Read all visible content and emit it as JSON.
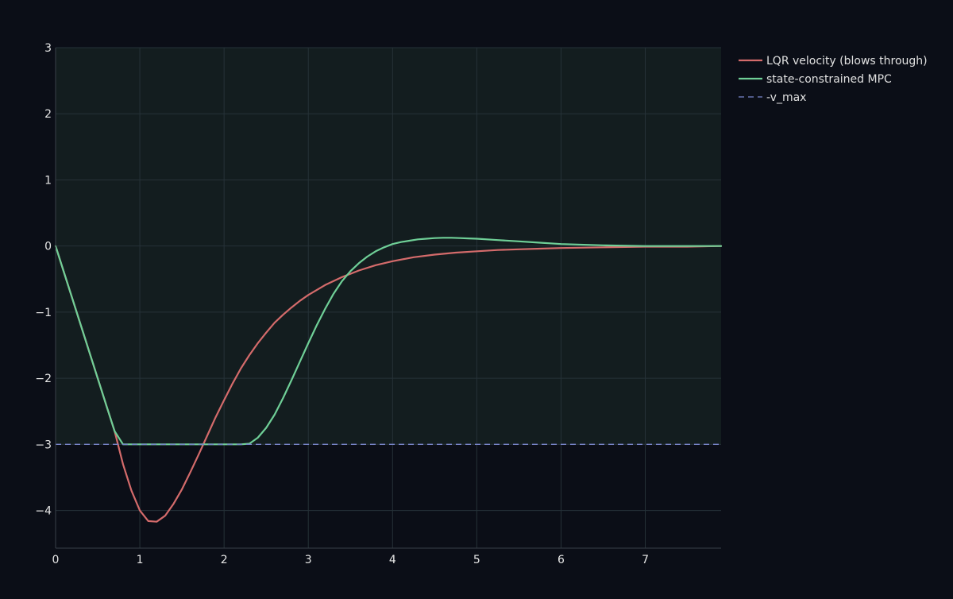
{
  "chart_data": {
    "type": "line",
    "title": "",
    "xlabel": "",
    "ylabel": "",
    "xlim": [
      0,
      7.9
    ],
    "ylim": [
      -4.57,
      3
    ],
    "x_ticks": [
      0,
      1,
      2,
      3,
      4,
      5,
      6,
      7
    ],
    "y_ticks": [
      3,
      2,
      1,
      0,
      -1,
      -2,
      -3,
      -4
    ],
    "x_tick_labels": [
      "0",
      "1",
      "2",
      "3",
      "4",
      "5",
      "6",
      "7"
    ],
    "y_tick_labels": [
      "3",
      "2",
      "1",
      "0",
      "−1",
      "−2",
      "−3",
      "−4"
    ],
    "grid": true,
    "legend_position": "top-right, outside plot",
    "colors": {
      "background": "#0b0e17",
      "feasible_region": "#131d1f",
      "grid": "#263238",
      "axis_line": "#3a4048",
      "tick_label": "#e6e6e6",
      "legend_text": "#e0e0e0"
    },
    "shaded_region": {
      "y_from": -3,
      "y_to": 3,
      "color": "#131d1f"
    },
    "series": [
      {
        "name": "LQR velocity (blows through)",
        "color": "#d46b6b",
        "dash": "solid",
        "x": [
          0,
          0.1,
          0.2,
          0.3,
          0.4,
          0.5,
          0.6,
          0.7,
          0.8,
          0.9,
          1.0,
          1.1,
          1.2,
          1.3,
          1.4,
          1.5,
          1.6,
          1.7,
          1.8,
          1.9,
          2.0,
          2.1,
          2.2,
          2.3,
          2.4,
          2.5,
          2.6,
          2.7,
          2.8,
          2.9,
          3.0,
          3.2,
          3.4,
          3.6,
          3.8,
          4.0,
          4.25,
          4.5,
          4.75,
          5.0,
          5.25,
          5.5,
          5.75,
          6.0,
          6.5,
          7.0,
          7.5,
          7.9
        ],
        "y": [
          0,
          -0.4,
          -0.8,
          -1.2,
          -1.6,
          -2.0,
          -2.4,
          -2.8,
          -3.3,
          -3.7,
          -4.0,
          -4.16,
          -4.17,
          -4.08,
          -3.9,
          -3.68,
          -3.42,
          -3.15,
          -2.87,
          -2.59,
          -2.33,
          -2.08,
          -1.85,
          -1.65,
          -1.47,
          -1.31,
          -1.16,
          -1.04,
          -0.93,
          -0.83,
          -0.74,
          -0.59,
          -0.47,
          -0.37,
          -0.29,
          -0.23,
          -0.17,
          -0.13,
          -0.1,
          -0.08,
          -0.06,
          -0.05,
          -0.04,
          -0.03,
          -0.02,
          -0.01,
          -0.01,
          0
        ]
      },
      {
        "name": "state-constrained MPC",
        "color": "#6fcf97",
        "dash": "solid",
        "x": [
          0,
          0.1,
          0.2,
          0.3,
          0.4,
          0.5,
          0.6,
          0.7,
          0.8,
          1.0,
          1.5,
          2.0,
          2.2,
          2.3,
          2.4,
          2.5,
          2.6,
          2.7,
          2.8,
          2.9,
          3.0,
          3.1,
          3.2,
          3.3,
          3.4,
          3.5,
          3.6,
          3.7,
          3.8,
          3.9,
          4.0,
          4.1,
          4.2,
          4.3,
          4.4,
          4.5,
          4.6,
          4.7,
          4.8,
          4.9,
          5.0,
          5.25,
          5.5,
          5.75,
          6.0,
          6.5,
          7.0,
          7.5,
          7.9
        ],
        "y": [
          0,
          -0.4,
          -0.8,
          -1.2,
          -1.6,
          -2.0,
          -2.4,
          -2.8,
          -3.0,
          -3.0,
          -3.0,
          -3.0,
          -3.0,
          -2.99,
          -2.9,
          -2.75,
          -2.55,
          -2.3,
          -2.03,
          -1.75,
          -1.47,
          -1.2,
          -0.95,
          -0.72,
          -0.53,
          -0.38,
          -0.26,
          -0.16,
          -0.08,
          -0.02,
          0.03,
          0.06,
          0.08,
          0.1,
          0.11,
          0.12,
          0.125,
          0.125,
          0.12,
          0.115,
          0.11,
          0.09,
          0.07,
          0.05,
          0.03,
          0.01,
          0.0,
          0.0,
          0.0
        ]
      },
      {
        "name": "-v_max",
        "color": "#7986cb",
        "dash": "dashed",
        "x": [
          0,
          7.9
        ],
        "y": [
          -3,
          -3
        ]
      }
    ]
  }
}
